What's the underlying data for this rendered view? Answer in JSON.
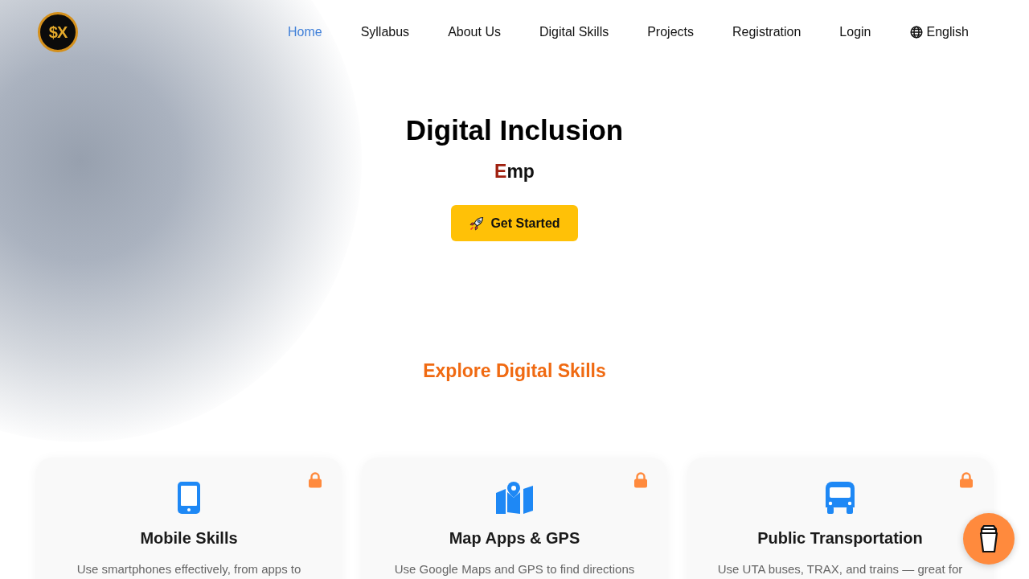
{
  "logo": {
    "text": "$X"
  },
  "nav": [
    {
      "label": "Home",
      "selected": true
    },
    {
      "label": "Syllabus",
      "selected": false
    },
    {
      "label": "About Us",
      "selected": false
    },
    {
      "label": "Digital Skills",
      "selected": false
    },
    {
      "label": "Projects",
      "selected": false
    },
    {
      "label": "Registration",
      "selected": false
    },
    {
      "label": "Login",
      "selected": false
    }
  ],
  "language": {
    "label": "English"
  },
  "hero": {
    "title": "Digital Inclusion",
    "typing_text": "Emp",
    "button": "Get Started"
  },
  "section_title": "Explore Digital Skills",
  "cards": [
    {
      "kind": "phone",
      "title": "Mobile Skills",
      "description": "Use smartphones effectively, from apps to",
      "locked": true
    },
    {
      "kind": "map",
      "title": "Map Apps & GPS",
      "description": "Use Google Maps and GPS to find directions",
      "locked": true
    },
    {
      "kind": "bus",
      "title": "Public Transportation",
      "description": "Use UTA buses, TRAX, and trains — great for",
      "locked": true
    }
  ]
}
